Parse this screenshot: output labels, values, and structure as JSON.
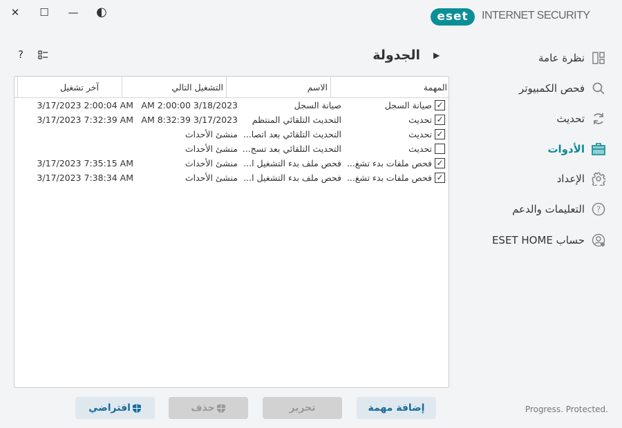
{
  "window": {
    "close": "✕",
    "maximize": "☐",
    "minimize": "—",
    "theme": "◐"
  },
  "brand": {
    "logo": "eset",
    "product": "INTERNET SECURITY",
    "tagline": "Progress. Protected.",
    "accent": "#0b8f97"
  },
  "sidebar": {
    "items": [
      {
        "label": "نظرة عامة",
        "icon": "dashboard-icon"
      },
      {
        "label": "فحص الكمبيوتر",
        "icon": "search-icon"
      },
      {
        "label": "تحديث",
        "icon": "refresh-icon"
      },
      {
        "label": "الأدوات",
        "icon": "toolbox-icon",
        "active": true
      },
      {
        "label": "الإعداد",
        "icon": "gear-icon"
      },
      {
        "label": "التعليمات والدعم",
        "icon": "help-icon"
      },
      {
        "label": "حساب ESET HOME",
        "icon": "user-icon"
      }
    ]
  },
  "page": {
    "title": "الجدولة",
    "help": "?"
  },
  "table": {
    "headers": [
      "المهمة",
      "الاسم",
      "التشغيل التالي",
      "آخر تشغيل"
    ],
    "rows": [
      {
        "checked": true,
        "task": "صيانة السجل",
        "name": "صيانة السجل",
        "next": "3/18/2023 2:00:00 AM",
        "last": "3/17/2023 2:00:04 AM"
      },
      {
        "checked": true,
        "task": "تحديث",
        "name": "التحديث التلقائي المنتظم",
        "next": "3/17/2023 8:32:39 AM",
        "last": "3/17/2023 7:32:39 AM"
      },
      {
        "checked": true,
        "task": "تحديث",
        "name": "التحديث التلقائي بعد اتصا...",
        "next": "منشئ الأحداث",
        "last": ""
      },
      {
        "checked": false,
        "task": "تحديث",
        "name": "التحديث التلقائي بعد تسج...",
        "next": "منشئ الأحداث",
        "last": ""
      },
      {
        "checked": true,
        "task": "فحص ملفات بدء تشغ...",
        "name": "فحص ملف بدء التشغيل ا...",
        "next": "منشئ الأحداث",
        "last": "3/17/2023 7:35:15 AM"
      },
      {
        "checked": true,
        "task": "فحص ملفات بدء تشغ...",
        "name": "فحص ملف بدء التشغيل ا...",
        "next": "منشئ الأحداث",
        "last": "3/17/2023 7:38:34 AM"
      }
    ]
  },
  "buttons": {
    "add": "إضافة مهمة",
    "edit": "تحرير",
    "delete": "حذف",
    "default": "افتراضي"
  }
}
